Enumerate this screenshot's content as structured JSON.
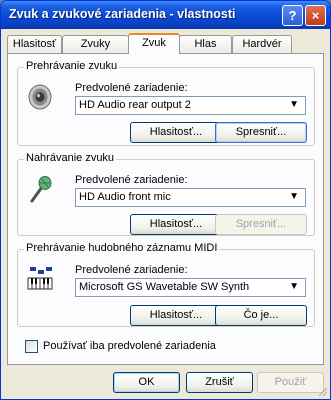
{
  "window": {
    "title": "Zvuk a zvukové zariadenia - vlastnosti",
    "help_label": "?",
    "close_label": "×"
  },
  "tabs": [
    {
      "label": "Hlasitosť",
      "active": false
    },
    {
      "label": "Zvuky",
      "active": false
    },
    {
      "label": "Zvuk",
      "active": true
    },
    {
      "label": "Hlas",
      "active": false
    },
    {
      "label": "Hardvér",
      "active": false
    }
  ],
  "playback": {
    "group_title": "Prehrávanie zvuku",
    "device_label": "Predvolené zariadenie:",
    "device_value": "HD Audio rear output 2",
    "volume_button": "Hlasitosť...",
    "advanced_button": "Spresniť..."
  },
  "recording": {
    "group_title": "Nahrávanie zvuku",
    "device_label": "Predvolené zariadenie:",
    "device_value": "HD Audio front mic",
    "volume_button": "Hlasitosť...",
    "advanced_button": "Spresniť..."
  },
  "midi": {
    "group_title": "Prehrávanie hudobného záznamu MIDI",
    "device_label": "Predvolené zariadenie:",
    "device_value": "Microsoft GS Wavetable SW Synth",
    "volume_button": "Hlasitosť...",
    "about_button": "Čo je..."
  },
  "default_only_checkbox": {
    "label": "Používať iba predvolené zariadenia",
    "checked": false
  },
  "dialog_buttons": {
    "ok": "OK",
    "cancel": "Zrušiť",
    "apply": "Použiť"
  }
}
